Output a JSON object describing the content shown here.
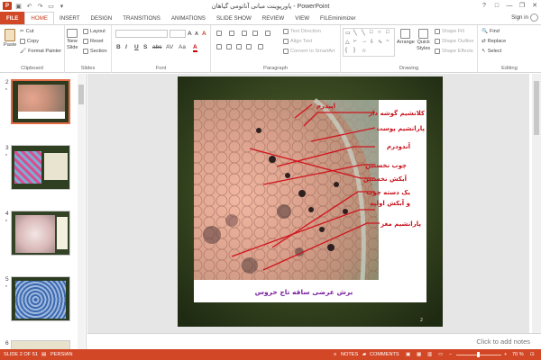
{
  "titlebar": {
    "title": "پاورپوینت مبانی آناتومی گیاهان - PowerPoint",
    "app_icon": "P",
    "qat": [
      "save-icon",
      "undo-icon",
      "redo-icon",
      "slideshow-icon",
      "customize-icon"
    ],
    "controls": [
      "?",
      "□",
      "—",
      "❐",
      "✕"
    ]
  },
  "tabs": [
    "FILE",
    "HOME",
    "INSERT",
    "DESIGN",
    "TRANSITIONS",
    "ANIMATIONS",
    "SLIDE SHOW",
    "REVIEW",
    "VIEW",
    "FILEminimizer"
  ],
  "signin": "Sign in",
  "ribbon": {
    "clipboard": {
      "paste": "Paste",
      "cut": "Cut",
      "copy": "Copy",
      "format_painter": "Format Painter",
      "label": "Clipboard"
    },
    "slides": {
      "new_slide": "New",
      "new_slide2": "Slide",
      "layout": "Layout",
      "reset": "Reset",
      "section": "Section",
      "label": "Slides"
    },
    "font": {
      "bold": "B",
      "italic": "I",
      "underline": "U",
      "strike": "S",
      "shadow": "abc",
      "spacing": "AV",
      "case": "Aa",
      "color": "A",
      "grow": "A",
      "shrink": "A",
      "clear": "A",
      "label": "Font"
    },
    "paragraph": {
      "text_direction": "Text Direction",
      "align_text": "Align Text",
      "smartart": "Convert to SmartArt",
      "label": "Paragraph"
    },
    "drawing": {
      "arrange": "Arrange",
      "quick_styles": "Quick",
      "quick_styles2": "Styles",
      "shape_fill": "Shape Fill",
      "shape_outline": "Shape Outline",
      "shape_effects": "Shape Effects",
      "label": "Drawing"
    },
    "editing": {
      "find": "Find",
      "replace": "Replace",
      "select": "Select",
      "label": "Editing"
    }
  },
  "thumbnails": [
    {
      "num": "2",
      "star": "*"
    },
    {
      "num": "3",
      "star": "*"
    },
    {
      "num": "4",
      "star": "*"
    },
    {
      "num": "5",
      "star": "*"
    },
    {
      "num": "6",
      "star": ""
    }
  ],
  "slide": {
    "labels": [
      "اپیدرم",
      "کلانشیم گوشه دار",
      "پارانشیم پوست",
      "آندودرم",
      "چوب نخستین",
      "آبکش نخستین",
      "یک دسته چوب",
      "و آبکش اولیه",
      "پارانشیم مغز"
    ],
    "caption": "برش عرضی ساقه تاج خروس",
    "page_num": "2"
  },
  "notes_placeholder": "Click to add notes",
  "status": {
    "slide": "SLIDE 2 OF 51",
    "language": "PERSIAN",
    "notes": "NOTES",
    "comments": "COMMENTS",
    "zoom": "70 %",
    "zoom_minus": "−",
    "zoom_plus": "+"
  }
}
